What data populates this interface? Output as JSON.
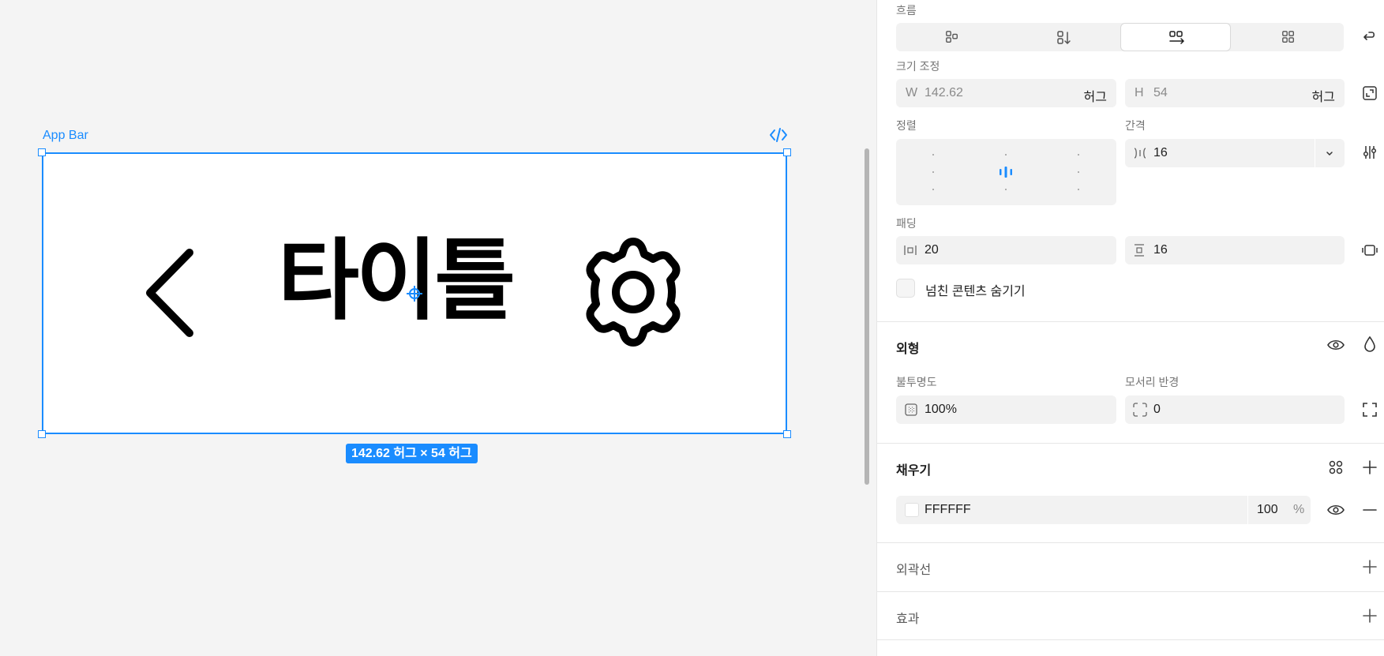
{
  "canvas": {
    "frame_label": "App Bar",
    "frame_title": "타이틀",
    "size_badge": "142.62 허그 × 54 허그"
  },
  "panel": {
    "flow": {
      "label": "흐름"
    },
    "resize": {
      "label": "크기 조정",
      "w_prefix": "W",
      "w_value": "142.62",
      "w_mode": "허그",
      "h_prefix": "H",
      "h_value": "54",
      "h_mode": "허그"
    },
    "align": {
      "label": "정렬"
    },
    "gap": {
      "label": "간격",
      "value": "16"
    },
    "padding": {
      "label": "패딩",
      "horizontal": "20",
      "vertical": "16"
    },
    "clip": {
      "label": "넘친 콘텐츠 숨기기"
    },
    "appearance": {
      "title": "외형",
      "opacity_label": "불투명도",
      "opacity_value": "100%",
      "radius_label": "모서리 반경",
      "radius_value": "0"
    },
    "fill": {
      "title": "채우기",
      "hex": "FFFFFF",
      "opacity": "100",
      "unit": "%"
    },
    "stroke": {
      "title": "외곽선"
    },
    "effects": {
      "title": "효과"
    }
  },
  "colors": {
    "accent": "#1a8cff",
    "panel_bg": "#ffffff",
    "canvas_bg": "#f4f4f4",
    "field_bg": "#f2f2f2"
  }
}
